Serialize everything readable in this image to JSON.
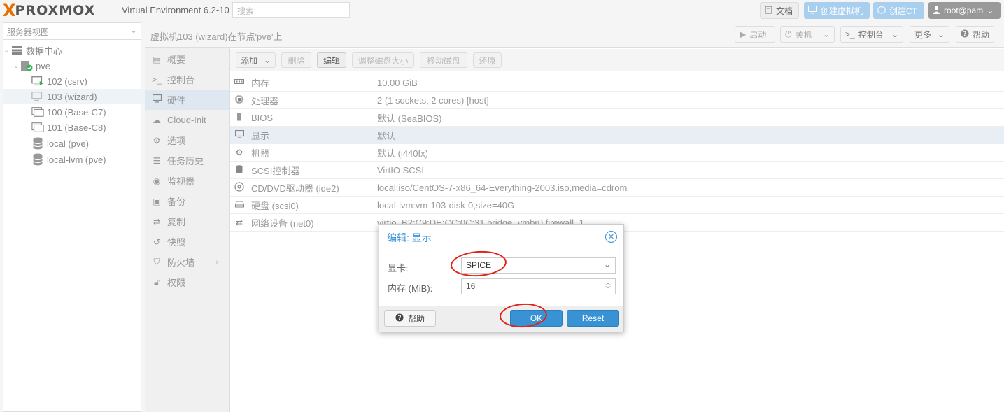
{
  "brand": {
    "logo_x": "X",
    "logo_text": "PROXMOX",
    "version": "Virtual Environment 6.2-10"
  },
  "topbar": {
    "search_placeholder": "搜索",
    "docs": "文档",
    "create_vm": "创建虚拟机",
    "create_ct": "创建CT",
    "user": "root@pam"
  },
  "tree": {
    "view": "服务器视图",
    "items": [
      {
        "label": "数据中心"
      },
      {
        "label": "pve"
      },
      {
        "label": "102 (csrv)"
      },
      {
        "label": "103 (wizard)"
      },
      {
        "label": "100 (Base-C7)"
      },
      {
        "label": "101 (Base-C8)"
      },
      {
        "label": "local (pve)"
      },
      {
        "label": "local-lvm (pve)"
      }
    ]
  },
  "content": {
    "title": "虚拟机103 (wizard)在节点'pve'上",
    "buttons": {
      "start": "启动",
      "shutdown": "关机",
      "console": "控制台",
      "more": "更多",
      "help": "帮助"
    }
  },
  "nav": [
    {
      "label": "概要"
    },
    {
      "label": "控制台"
    },
    {
      "label": "硬件"
    },
    {
      "label": "Cloud-Init"
    },
    {
      "label": "选项"
    },
    {
      "label": "任务历史"
    },
    {
      "label": "监视器"
    },
    {
      "label": "备份"
    },
    {
      "label": "复制"
    },
    {
      "label": "快照"
    },
    {
      "label": "防火墙"
    },
    {
      "label": "权限"
    }
  ],
  "hw_toolbar": {
    "add": "添加",
    "remove": "删除",
    "edit": "编辑",
    "resize": "调整磁盘大小",
    "move": "移动磁盘",
    "revert": "还原"
  },
  "hardware": [
    {
      "name": "内存",
      "value": "10.00 GiB"
    },
    {
      "name": "处理器",
      "value": "2 (1 sockets, 2 cores) [host]"
    },
    {
      "name": "BIOS",
      "value": "默认 (SeaBIOS)"
    },
    {
      "name": "显示",
      "value": "默认"
    },
    {
      "name": "机器",
      "value": "默认 (i440fx)"
    },
    {
      "name": "SCSI控制器",
      "value": "VirtIO SCSI"
    },
    {
      "name": "CD/DVD驱动器 (ide2)",
      "value": "local:iso/CentOS-7-x86_64-Everything-2003.iso,media=cdrom"
    },
    {
      "name": "硬盘 (scsi0)",
      "value": "local-lvm:vm-103-disk-0,size=40G"
    },
    {
      "name": "网络设备 (net0)",
      "value": "virtio=B2:C9:DE:CC:0C:31,bridge=vmbr0,firewall=1"
    }
  ],
  "dialog": {
    "title": "编辑: 显示",
    "card_label": "显卡:",
    "card_value": "SPICE",
    "mem_label": "内存 (MiB):",
    "mem_value": "16",
    "help": "帮助",
    "ok": "OK",
    "reset": "Reset"
  },
  "colors": {
    "accent": "#3892d4",
    "brand_orange": "#e57000",
    "annotation_red": "#e0231a"
  }
}
